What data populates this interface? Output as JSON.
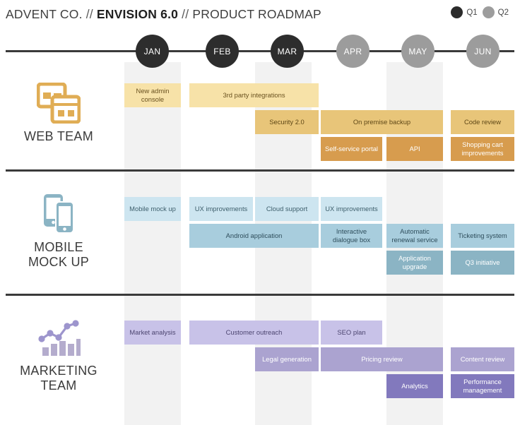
{
  "header": {
    "company": "ADVENT CO.",
    "sep1": "//",
    "product": "ENVISION 6.0",
    "sep2": "//",
    "title": "PRODUCT ROADMAP"
  },
  "legend": {
    "items": [
      {
        "label": "Q1",
        "color": "#2b2b2b"
      },
      {
        "label": "Q2",
        "color": "#9d9d9d"
      }
    ]
  },
  "timeline": {
    "months": [
      {
        "label": "JAN",
        "quarter": "Q1",
        "color": "#2d2d2d"
      },
      {
        "label": "FEB",
        "quarter": "Q1",
        "color": "#2d2d2d"
      },
      {
        "label": "MAR",
        "quarter": "Q1",
        "color": "#2d2d2d"
      },
      {
        "label": "APR",
        "quarter": "Q2",
        "color": "#9c9c9c"
      },
      {
        "label": "MAY",
        "quarter": "Q2",
        "color": "#9c9c9c"
      },
      {
        "label": "JUN",
        "quarter": "Q2",
        "color": "#9c9c9c"
      }
    ]
  },
  "lanes": [
    {
      "id": "web",
      "name": "WEB TEAM",
      "icon": "browser-windows-icon",
      "accent": "#e0ad55",
      "tasks": [
        {
          "label": "New admin console",
          "tier": 1,
          "start": "JAN",
          "end": "JAN",
          "shade": "light"
        },
        {
          "label": "3rd party integrations",
          "tier": 1,
          "start": "FEB",
          "end": "MAR",
          "shade": "light"
        },
        {
          "label": "Security 2.0",
          "tier": 2,
          "start": "MAR",
          "end": "MAR",
          "shade": "medium"
        },
        {
          "label": "On premise backup",
          "tier": 2,
          "start": "APR",
          "end": "MAY",
          "shade": "medium"
        },
        {
          "label": "Code review",
          "tier": 2,
          "start": "JUN",
          "end": "JUN",
          "shade": "medium"
        },
        {
          "label": "Self-service portal",
          "tier": 3,
          "start": "APR",
          "end": "APR",
          "shade": "dark"
        },
        {
          "label": "API",
          "tier": 3,
          "start": "MAY",
          "end": "MAY",
          "shade": "dark"
        },
        {
          "label": "Shopping cart improvements",
          "tier": 3,
          "start": "JUN",
          "end": "JUN",
          "shade": "dark"
        }
      ]
    },
    {
      "id": "mobile",
      "name": "MOBILE MOCK UP",
      "name_line1": "MOBILE",
      "name_line2": "MOCK UP",
      "icon": "mobile-phones-icon",
      "accent": "#8bb4c4",
      "tasks": [
        {
          "label": "Mobile mock up",
          "tier": 1,
          "start": "JAN",
          "end": "JAN",
          "shade": "light"
        },
        {
          "label": "UX improvements",
          "tier": 1,
          "start": "FEB",
          "end": "FEB",
          "shade": "light"
        },
        {
          "label": "Cloud support",
          "tier": 1,
          "start": "MAR",
          "end": "MAR",
          "shade": "light"
        },
        {
          "label": "UX improvements",
          "tier": 1,
          "start": "APR",
          "end": "APR",
          "shade": "light"
        },
        {
          "label": "Android application",
          "tier": 2,
          "start": "FEB",
          "end": "MAR",
          "shade": "medium"
        },
        {
          "label": "Interactive dialogue box",
          "tier": 2,
          "start": "APR",
          "end": "APR",
          "shade": "medium"
        },
        {
          "label": "Automatic renewal service",
          "tier": 2,
          "start": "MAY",
          "end": "MAY",
          "shade": "medium"
        },
        {
          "label": "Ticketing system",
          "tier": 2,
          "start": "JUN",
          "end": "JUN",
          "shade": "medium"
        },
        {
          "label": "Application upgrade",
          "tier": 3,
          "start": "MAY",
          "end": "MAY",
          "shade": "dark"
        },
        {
          "label": "Q3 initiative",
          "tier": 3,
          "start": "JUN",
          "end": "JUN",
          "shade": "dark"
        }
      ]
    },
    {
      "id": "marketing",
      "name": "MARKETING TEAM",
      "name_line1": "MARKETING",
      "name_line2": "TEAM",
      "icon": "bar-chart-growth-icon",
      "accent": "#8279bd",
      "tasks": [
        {
          "label": "Market analysis",
          "tier": 1,
          "start": "JAN",
          "end": "JAN",
          "shade": "light"
        },
        {
          "label": "Customer outreach",
          "tier": 1,
          "start": "FEB",
          "end": "MAR",
          "shade": "light"
        },
        {
          "label": "SEO plan",
          "tier": 1,
          "start": "APR",
          "end": "APR",
          "shade": "light"
        },
        {
          "label": "Legal generation",
          "tier": 2,
          "start": "MAR",
          "end": "MAR",
          "shade": "medium"
        },
        {
          "label": "Pricing review",
          "tier": 2,
          "start": "APR",
          "end": "MAY",
          "shade": "medium"
        },
        {
          "label": "Content review",
          "tier": 2,
          "start": "JUN",
          "end": "JUN",
          "shade": "medium"
        },
        {
          "label": "Analytics",
          "tier": 3,
          "start": "MAY",
          "end": "MAY",
          "shade": "dark"
        },
        {
          "label": "Performance management",
          "tier": 3,
          "start": "JUN",
          "end": "JUN",
          "shade": "dark"
        }
      ]
    }
  ],
  "colors": {
    "web": {
      "light": "#f7e2a8",
      "medium": "#e8c579",
      "dark": "#d79c4e"
    },
    "mobile": {
      "light": "#cde5f0",
      "medium": "#a8cddd",
      "dark": "#8bb4c4"
    },
    "marketing": {
      "light": "#c8c2e8",
      "medium": "#aba3d0",
      "dark": "#8279bd"
    },
    "band": "#f2f2f2",
    "rule": "#3a3a3a"
  }
}
